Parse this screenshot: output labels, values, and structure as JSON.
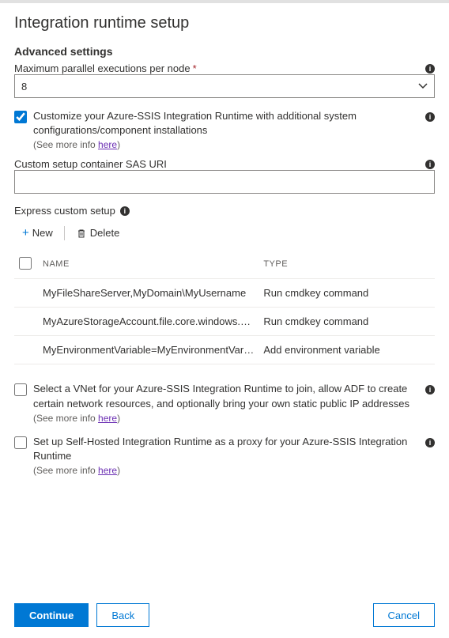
{
  "title": "Integration runtime setup",
  "section": "Advanced settings",
  "maxParallel": {
    "label": "Maximum parallel executions per node",
    "value": "8"
  },
  "customize": {
    "label": "Customize your Azure-SSIS Integration Runtime with additional system configurations/component installations",
    "hintPrefix": "(See more info ",
    "hintLink": "here",
    "hintSuffix": ")"
  },
  "sasUri": {
    "label": "Custom setup container SAS URI",
    "value": ""
  },
  "express": {
    "label": "Express custom setup",
    "newLabel": "New",
    "deleteLabel": "Delete",
    "colName": "NAME",
    "colType": "TYPE",
    "rows": [
      {
        "name": "MyFileShareServer,MyDomain\\MyUsername",
        "type": "Run cmdkey command"
      },
      {
        "name": "MyAzureStorageAccount.file.core.windows.net,azu...",
        "type": "Run cmdkey command"
      },
      {
        "name": "MyEnvironmentVariable=MyEnvironmentVariableValu...",
        "type": "Add environment variable"
      }
    ]
  },
  "vnet": {
    "label": "Select a VNet for your Azure-SSIS Integration Runtime to join, allow ADF to create certain network resources, and optionally bring your own static public IP addresses",
    "hintPrefix": "(See more info ",
    "hintLink": "here",
    "hintSuffix": ")"
  },
  "proxy": {
    "label": "Set up Self-Hosted Integration Runtime as a proxy for your Azure-SSIS Integration Runtime",
    "hintPrefix": "(See more info ",
    "hintLink": "here",
    "hintSuffix": ")"
  },
  "buttons": {
    "continue": "Continue",
    "back": "Back",
    "cancel": "Cancel"
  }
}
